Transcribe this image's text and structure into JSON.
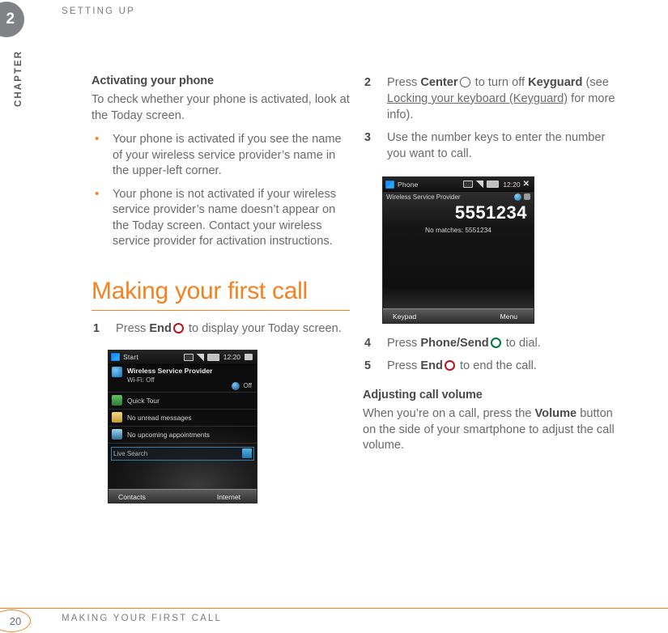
{
  "chapter": {
    "number": "2",
    "label": "CHAPTER",
    "running_head": "SETTING UP"
  },
  "left_column": {
    "subhead": "Activating your phone",
    "intro": "To check whether your phone is activated, look at the Today screen.",
    "bullets": [
      "Your phone is activated if you see the name of your wireless service provider’s name in the upper-left corner.",
      "Your phone is not activated if your wireless service provider’s name doesn’t appear on the Today screen. Contact your wireless service provider for activation instructions."
    ],
    "section_head": "Making your first call",
    "step1": {
      "num": "1",
      "pre": "Press ",
      "key": "End",
      "icon": "end-key-ring-icon",
      "post": " to display your Today screen."
    }
  },
  "right_column": {
    "step2": {
      "num": "2",
      "pre": "Press ",
      "key": "Center",
      "icon": "center-key-ring-icon",
      "mid": " to turn off ",
      "key2": "Keyguard",
      "see": " (see ",
      "link": "Locking your keyboard (Keyguard)",
      "post": " for more info)."
    },
    "step3": {
      "num": "3",
      "text": "Use the number keys to enter the number you want to call."
    },
    "step4": {
      "num": "4",
      "pre": "Press ",
      "key": "Phone/Send",
      "icon": "phone-send-key-ring-icon",
      "post": " to dial."
    },
    "step5": {
      "num": "5",
      "pre": "Press ",
      "key": "End",
      "icon": "end-key-ring-icon",
      "post": " to end the call."
    },
    "subhead": "Adjusting call volume",
    "volume_pre": "When you’re on a call, press the ",
    "volume_key": "Volume",
    "volume_post": " button on the side of your smartphone to adjust the call volume."
  },
  "today_screenshot": {
    "name": "today-screen-image",
    "statusbar": {
      "start": "Start",
      "time": "12:20"
    },
    "rows": [
      {
        "title": "Wireless Service Provider",
        "sub": "Wi-Fi: Off",
        "bt_state": "Off"
      },
      {
        "title": "Quick Tour"
      },
      {
        "title": "No unread messages"
      },
      {
        "title": "No upcoming appointments"
      }
    ],
    "search_placeholder": "Live Search",
    "softkey_left": "Contacts",
    "softkey_right": "Internet"
  },
  "phone_screenshot": {
    "name": "phone-dialer-image",
    "statusbar": {
      "title": "Phone",
      "time": "12:20"
    },
    "provider": "Wireless Service Provider",
    "number": "5551234",
    "no_match": "No matches: 5551234",
    "softkey_left": "Keypad",
    "softkey_right": "Menu"
  },
  "footer": {
    "page_number": "20",
    "title": "MAKING YOUR FIRST CALL"
  },
  "colors": {
    "accent_orange": "#F5821F",
    "body_gray": "#6A6A6D",
    "heading_gray": "#4A4A4D",
    "badge_gray": "#808285",
    "end_key_red": "#B3151F",
    "send_key_green": "#00773B"
  }
}
